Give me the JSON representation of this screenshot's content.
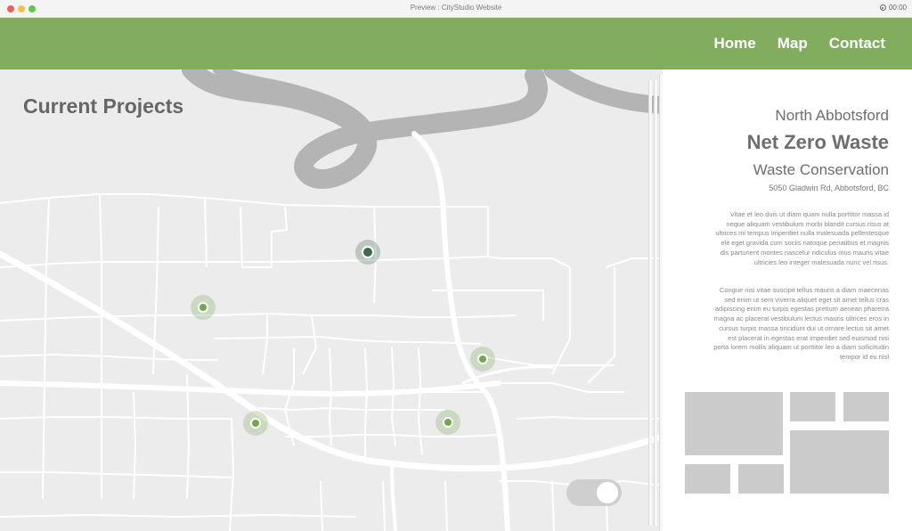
{
  "window": {
    "title": "Preview : CityStudio Website",
    "time": "00:00",
    "colors": {
      "close": "#ee5f58",
      "minimize": "#f6be4f",
      "maximize": "#5cc84d"
    }
  },
  "header": {
    "background": "#82ad5f",
    "nav": [
      {
        "label": "Home"
      },
      {
        "label": "Map"
      },
      {
        "label": "Contact"
      }
    ]
  },
  "map": {
    "title": "Current Projects",
    "markers": [
      {
        "id": "marker-1",
        "active": true
      },
      {
        "id": "marker-2",
        "active": false
      },
      {
        "id": "marker-3",
        "active": false
      },
      {
        "id": "marker-4",
        "active": false
      },
      {
        "id": "marker-5",
        "active": false
      }
    ],
    "toggle": {
      "on": true
    }
  },
  "project": {
    "region": "North Abbotsford",
    "name": "Net Zero Waste",
    "category": "Waste Conservation",
    "address": "5050 Gladwin Rd, Abbotsford, BC",
    "paragraphs": [
      "Vitae et leo duis ut diam quam nulla porttitor massa id neque aliquam vestibulum morbi blandit cursus risus at ultrices mi tempus imperdiet nulla malesuada pellentesque elit eget gravida cum sociis natoque penatibus et magnis dis parturient montes nascetur ridiculus mus mauris vitae ultricies leo integer malesuada nunc vel risus.",
      "Congue nisi vitae suscipit tellus mauris a diam maecenas sed enim ut sem viverra aliquet eget sit amet tellus cras adipiscing enim eu turpis egestas pretium aenean pharetra magna ac placerat vestibulum lectus mauris ultrices eros in cursus turpis massa tincidunt dui ut ornare lectus sit amet est placerat in egestas erat imperdiet sed euismod nisi porta lorem mollis aliquam ut porttitor leo a diam sollicitudin tempor id eu nisl"
    ],
    "gallery_count": 6
  }
}
